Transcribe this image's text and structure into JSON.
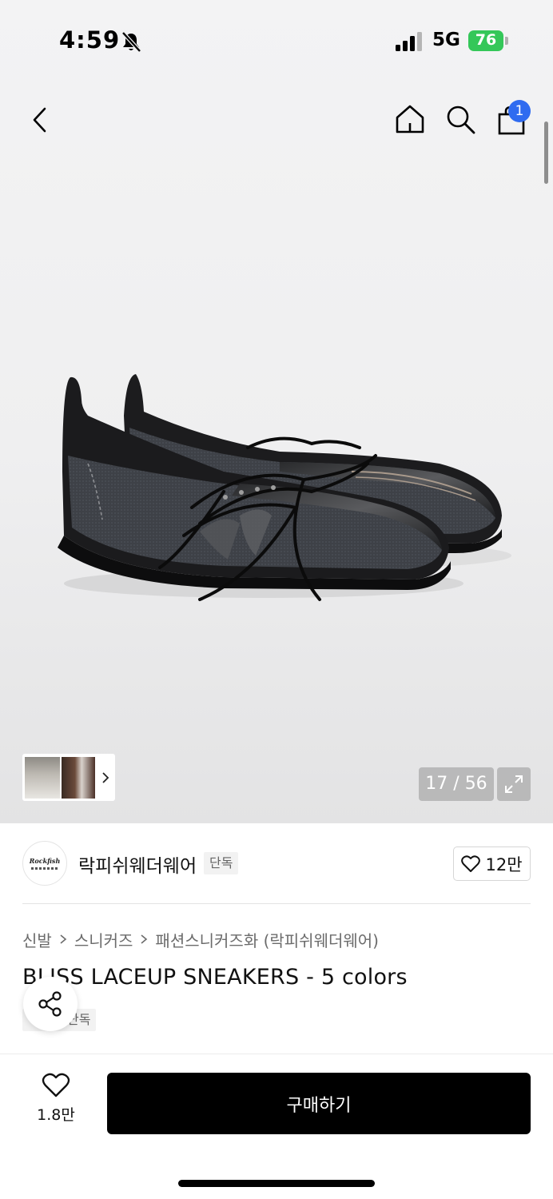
{
  "status_bar": {
    "time": "4:59",
    "network": "5G",
    "battery": "76"
  },
  "nav": {
    "cart_count": "1"
  },
  "gallery": {
    "counter": "17 / 56"
  },
  "brand": {
    "logo_text": "Rockfish",
    "name": "락피쉬웨더웨어",
    "exclusive_label": "단독",
    "like_count": "12만"
  },
  "breadcrumb": [
    "신발",
    "스니커즈",
    "패션스니커즈화 (락피쉬웨더웨어)"
  ],
  "product": {
    "title": "BLISS LACEUP SNEAKERS - 5 colors",
    "badge": "단독"
  },
  "bottom_bar": {
    "wish_count": "1.8만",
    "buy_label": "구매하기"
  },
  "colors": {
    "buy_button": "#000000",
    "badge_blue": "#2f6bf0",
    "battery_green": "#34c759"
  },
  "icons": [
    "bell-slash-icon",
    "signal-icon",
    "back-icon",
    "home-icon",
    "search-icon",
    "shopping-bag-icon",
    "chevron-right-icon",
    "expand-icon",
    "heart-icon",
    "share-icon"
  ]
}
